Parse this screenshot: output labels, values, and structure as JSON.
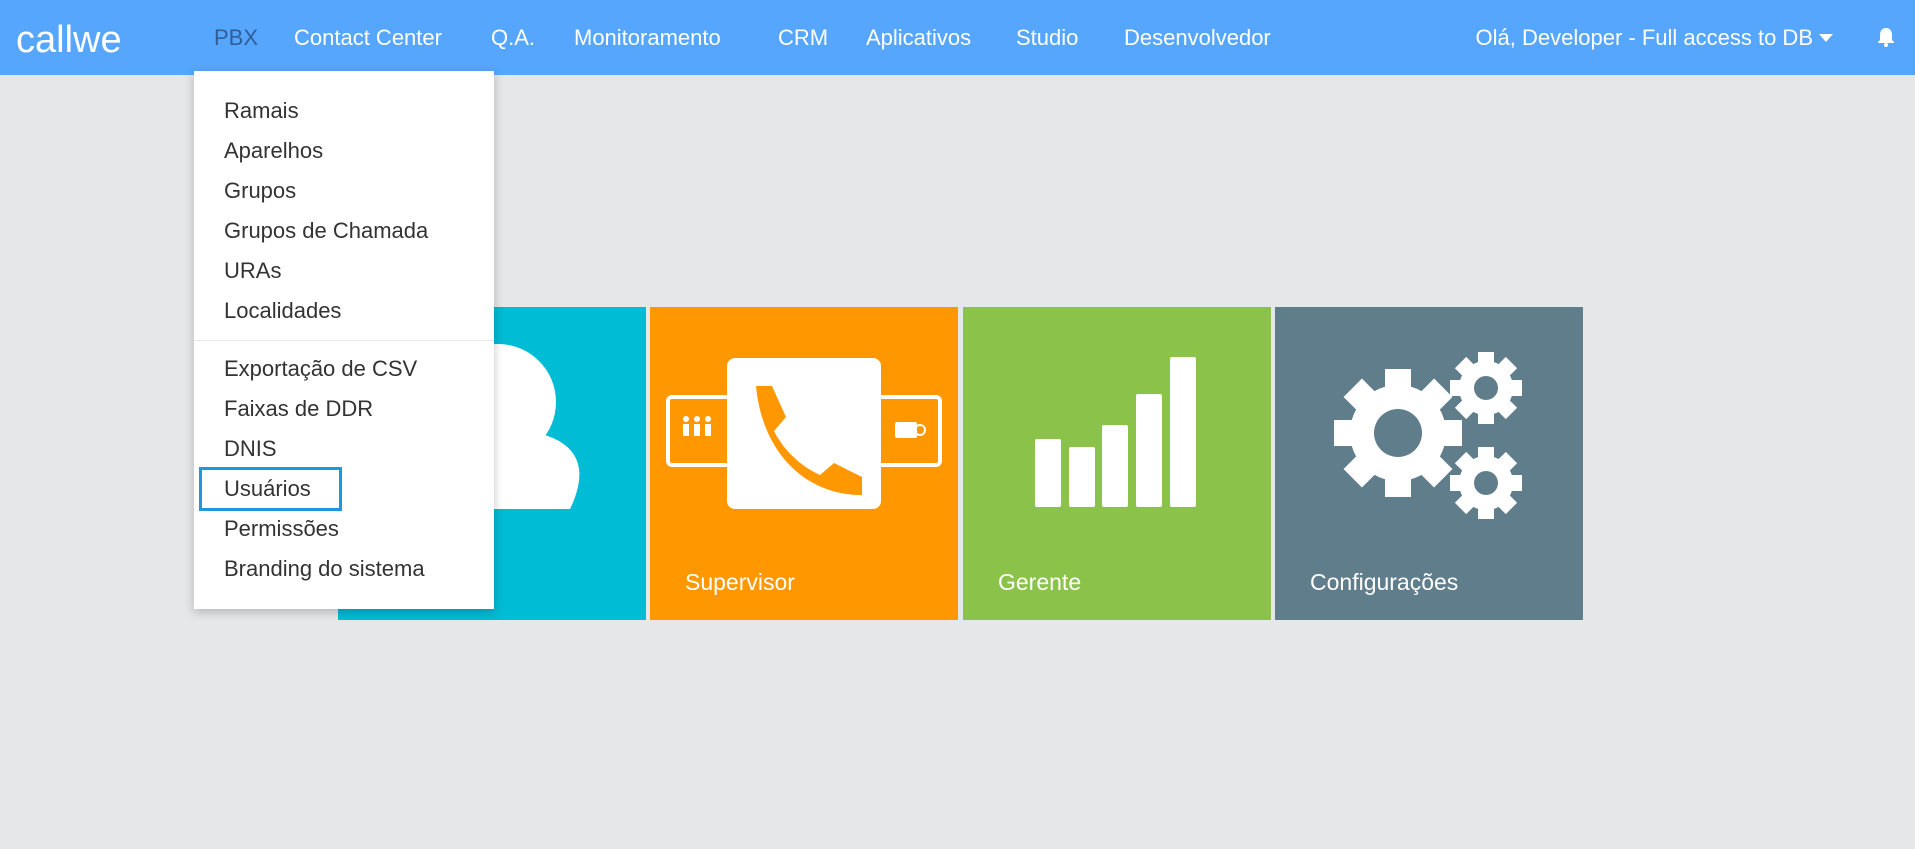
{
  "brand": {
    "logo_text": "callwe",
    "colors": {
      "topbar": "#56a6fe",
      "background": "#e6e7e9",
      "tile_agent": "#00bcd4",
      "tile_supervisor": "#ff9800",
      "tile_manager": "#8bc34a",
      "tile_settings": "#607d8b",
      "highlight": "#1f97dc"
    }
  },
  "nav": {
    "items": [
      {
        "label": "PBX",
        "active": true
      },
      {
        "label": "Contact Center"
      },
      {
        "label": "Q.A."
      },
      {
        "label": "Monitoramento"
      },
      {
        "label": "CRM"
      },
      {
        "label": "Aplicativos"
      },
      {
        "label": "Studio"
      },
      {
        "label": "Desenvolvedor"
      }
    ],
    "user_greeting": "Olá, Developer - Full access to DB",
    "user_menu_icon": "caret-down-icon",
    "notifications_icon": "bell-icon"
  },
  "pbx_menu": {
    "group1": [
      "Ramais",
      "Aparelhos",
      "Grupos",
      "Grupos de Chamada",
      "URAs",
      "Localidades"
    ],
    "group2": [
      "Exportação de CSV",
      "Faixas de DDR",
      "DNIS",
      "Usuários",
      "Permissões",
      "Branding do sistema"
    ],
    "highlighted_item": "Usuários"
  },
  "tiles": [
    {
      "caption": "",
      "icon": "person-icon"
    },
    {
      "caption": "Supervisor",
      "icon": "phone-headset-icon"
    },
    {
      "caption": "Gerente",
      "icon": "bar-chart-icon"
    },
    {
      "caption": "Configurações",
      "icon": "gears-icon"
    }
  ]
}
